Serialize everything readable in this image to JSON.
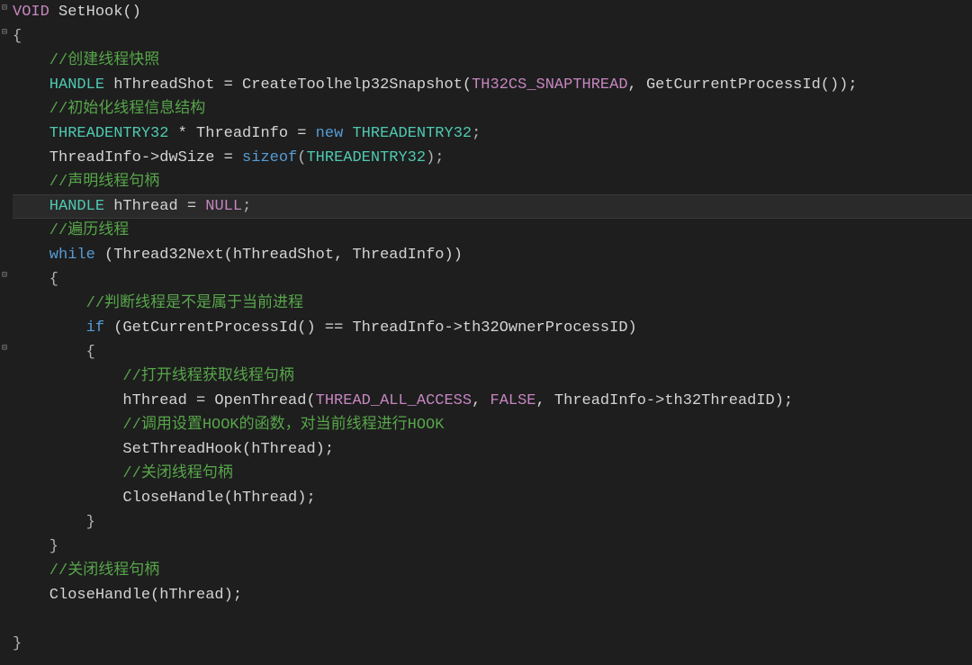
{
  "code": {
    "l1_void": "VOID",
    "l1_func": " SetHook()",
    "l2_brace": "{",
    "l3_comment": "    //创建线程快照",
    "l4_type": "    HANDLE",
    "l4_mid": " hThreadShot = CreateToolhelp32Snapshot(",
    "l4_const": "TH32CS_SNAPTHREAD",
    "l4_end": ", GetCurrentProcessId());",
    "l5_comment": "    //初始化线程信息结构",
    "l6_type1": "    THREADENTRY32",
    "l6_mid1": " * ThreadInfo = ",
    "l6_kw_new": "new",
    "l6_sp": " ",
    "l6_type2": "THREADENTRY32",
    "l6_end": ";",
    "l7_pre": "    ThreadInfo->dwSize = ",
    "l7_kw": "sizeof",
    "l7_paren": "(",
    "l7_type": "THREADENTRY32",
    "l7_end": ");",
    "l8_comment": "    //声明线程句柄",
    "l9_type": "    HANDLE",
    "l9_mid": " hThread = ",
    "l9_const": "NULL",
    "l9_end": ";",
    "l10_comment": "    //遍历线程",
    "l11_kw": "    while",
    "l11_rest": " (Thread32Next(hThreadShot, ThreadInfo))",
    "l12_brace": "    {",
    "l13_comment": "        //判断线程是不是属于当前进程",
    "l14_kw": "        if",
    "l14_rest": " (GetCurrentProcessId() == ThreadInfo->th32OwnerProcessID)",
    "l15_brace": "        {",
    "l16_comment": "            //打开线程获取线程句柄",
    "l17_pre": "            hThread = OpenThread(",
    "l17_c1": "THREAD_ALL_ACCESS",
    "l17_m1": ", ",
    "l17_c2": "FALSE",
    "l17_m2": ", ThreadInfo->th32ThreadID);",
    "l18_comment": "            //调用设置HOOK的函数，对当前线程进行HOOK",
    "l19_text": "            SetThreadHook(hThread);",
    "l20_comment": "            //关闭线程句柄",
    "l21_text": "            CloseHandle(hThread);",
    "l22_brace": "        }",
    "l23_brace": "    }",
    "l24_comment": "    //关闭线程句柄",
    "l25_text": "    CloseHandle(hThread);",
    "l26_blank": "",
    "l27_brace": "}"
  }
}
